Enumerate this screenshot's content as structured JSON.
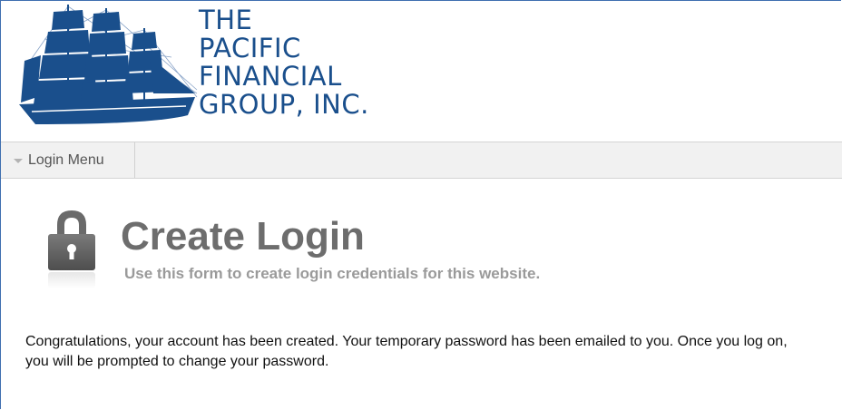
{
  "header": {
    "logo_lines": [
      "THE",
      "PACIFIC",
      "FINANCIAL",
      "GROUP, INC."
    ],
    "logo_color": "#1a4f8c",
    "logo_icon": "sailing-ship-icon"
  },
  "nav": {
    "items": [
      {
        "label": "Login Menu",
        "icon": "caret-down-icon"
      }
    ]
  },
  "page": {
    "icon": "padlock-icon",
    "title": "Create Login",
    "subtitle": "Use this form to create login credentials for this website.",
    "message": "Congratulations, your account has been created. Your temporary password has been emailed to you. Once you log on, you will be prompted to change your password."
  },
  "colors": {
    "frame_border": "#3f6fb0",
    "title": "#6d6d6d",
    "subtitle": "#9a9a9a",
    "navbar_bg": "#f1f1f1"
  }
}
